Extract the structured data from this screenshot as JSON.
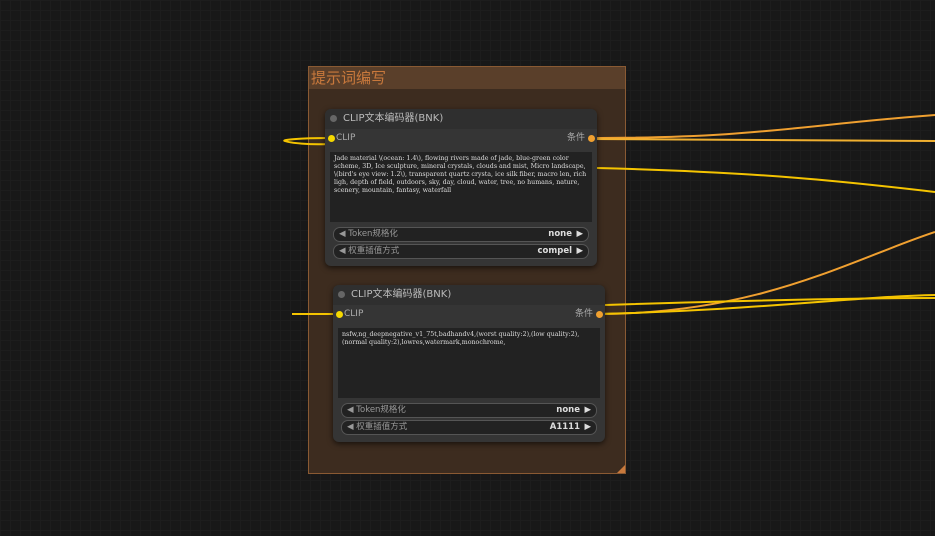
{
  "group": {
    "title": "提示词编写"
  },
  "nodes": [
    {
      "title": "CLIP文本编码器(BNK)",
      "input": "CLIP",
      "output": "条件",
      "text": "Jade material \\(ocean: 1.4\\), flowing rivers made of jade, blue-green color scheme, 3D, Ice sculpture, mineral crystals, clouds and mist, Micro landscape, \\(bird's eye view: 1.2\\), transparent quartz crysta, ice silk fiber, macro len,  rich ligh, depth of field, outdoors, sky, day, cloud, water, tree, no humans, nature, scenery, mountain, fantasy, waterfall",
      "widgets": [
        {
          "label": "Token规格化",
          "value": "none"
        },
        {
          "label": "权重插值方式",
          "value": "compel"
        }
      ]
    },
    {
      "title": "CLIP文本编码器(BNK)",
      "input": "CLIP",
      "output": "条件",
      "text": "nsfw,ng_deepnegative_v1_75t,badhandv4,(worst quality:2),(low quality:2),(normal quality:2),lowres,watermark,monochrome,",
      "widgets": [
        {
          "label": "Token规格化",
          "value": "none"
        },
        {
          "label": "权重插值方式",
          "value": "A1111"
        }
      ]
    }
  ],
  "colors": {
    "wire_clip": "#f5d800",
    "wire_cond": "#f0a030",
    "group": "#8a5a33"
  }
}
